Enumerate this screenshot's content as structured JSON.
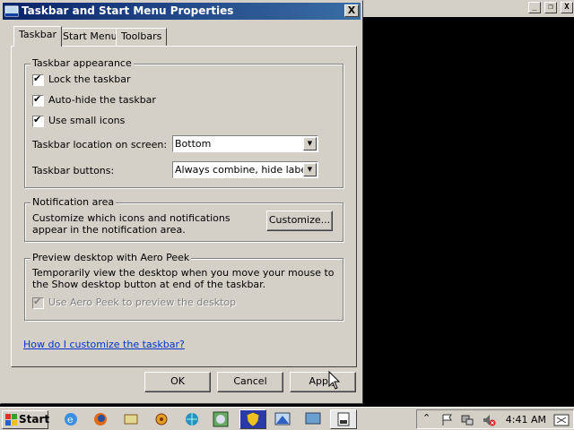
{
  "dialog": {
    "title": "Taskbar and Start Menu Properties",
    "close_label": "X"
  },
  "outer_window": {
    "minimize": "_",
    "restore": "❐",
    "close": "X"
  },
  "tabs": [
    {
      "label": "Taskbar",
      "active": true
    },
    {
      "label": "Start Menu",
      "active": false
    },
    {
      "label": "Toolbars",
      "active": false
    }
  ],
  "appearance": {
    "legend": "Taskbar appearance",
    "lock": {
      "label": "Lock the taskbar",
      "checked": true
    },
    "autohide": {
      "label": "Auto-hide the taskbar",
      "checked": true
    },
    "small_icons": {
      "label": "Use small icons",
      "checked": true
    },
    "location_label": "Taskbar location on screen:",
    "location_value": "Bottom",
    "buttons_label": "Taskbar buttons:",
    "buttons_value": "Always combine, hide labels"
  },
  "notification": {
    "legend": "Notification area",
    "text": "Customize which icons and notifications appear in the notification area.",
    "customize_label": "Customize..."
  },
  "peek": {
    "legend": "Preview desktop with Aero Peek",
    "text": "Temporarily view the desktop when you move your mouse to the Show desktop button at end of the taskbar.",
    "checkbox_label": "Use Aero Peek to preview the desktop",
    "checked": true,
    "enabled": false
  },
  "help_link": "How do I customize the taskbar?",
  "buttons": {
    "ok": "OK",
    "cancel": "Cancel",
    "apply": "Apply"
  },
  "taskbar": {
    "start_label": "Start",
    "clock": "4:41 AM",
    "quick_icons": [
      "ie-icon",
      "firefox-icon",
      "network-icon",
      "settings-icon",
      "globe-icon",
      "dvd-icon",
      "shield-icon",
      "desktop-icon",
      "monitor-icon",
      "window-icon"
    ]
  }
}
